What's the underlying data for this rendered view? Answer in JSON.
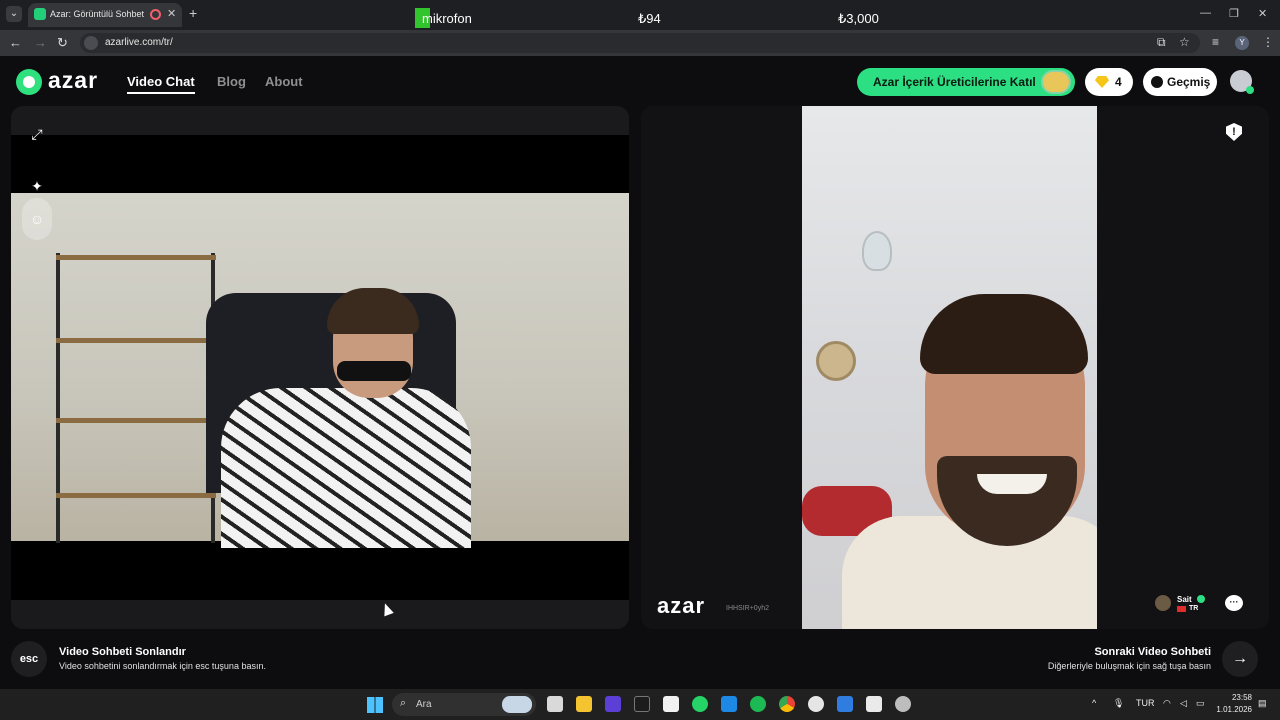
{
  "browser": {
    "tab_title": "Azar: Görüntülü Sohbet & V",
    "url": "azarlive.com/tr/",
    "new_tab": "+",
    "close_glyph": "✕"
  },
  "overlay": {
    "mic_label": "mikrofon",
    "value_1": "₺94",
    "value_2": "₺3,000"
  },
  "site": {
    "logo": "azar",
    "nav": [
      {
        "label": "Video Chat",
        "active": true
      },
      {
        "label": "Blog",
        "active": false
      },
      {
        "label": "About",
        "active": false
      }
    ],
    "creator_button": "Azar İçerik Üreticilerine Katıl",
    "gem_count": "4",
    "history_button": "Geçmiş"
  },
  "partner": {
    "logo": "azar",
    "code": "IHHSIR+0yh2",
    "name": "Sait",
    "country": "TR"
  },
  "controls": {
    "esc_label": "esc",
    "end_title": "Video Sohbeti Sonlandır",
    "end_desc": "Video sohbetini sonlandırmak için esc tuşuna basın.",
    "next_title": "Sonraki Video Sohbeti",
    "next_desc": "Diğerleriyle buluşmak için sağ tuşa basın",
    "next_arrow": "→"
  },
  "taskbar": {
    "search_placeholder": "Ara",
    "language": "TUR",
    "time": "23:58",
    "date": "1.01.2026",
    "whatsapp_badge": "4"
  },
  "colors": {
    "brand_green": "#2ddf83",
    "background": "#0d0d0f"
  }
}
